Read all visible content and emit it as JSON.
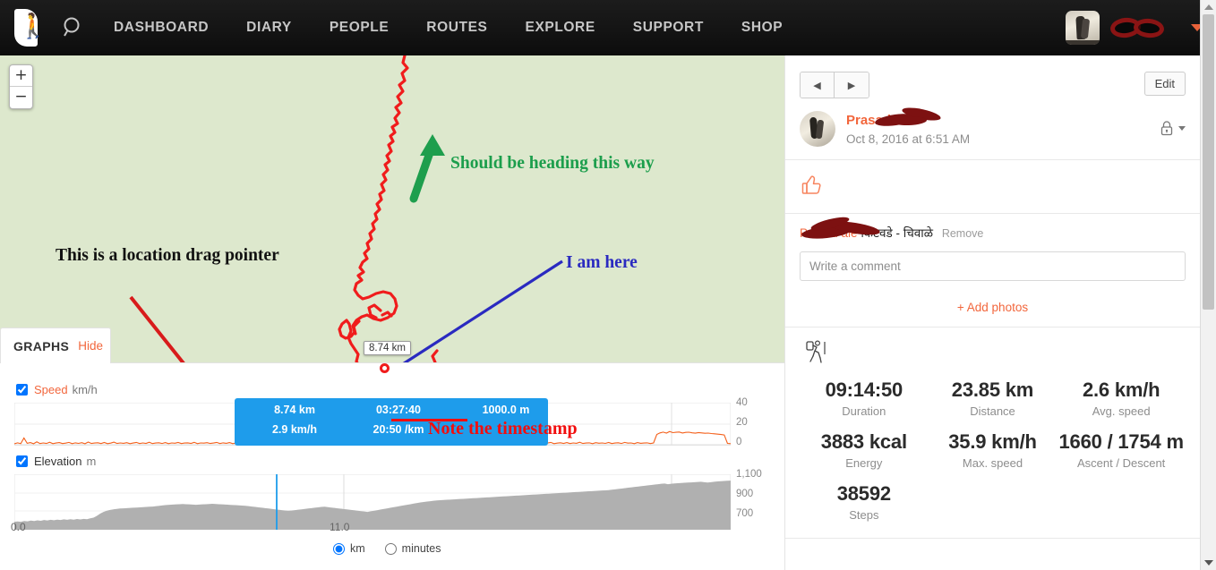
{
  "nav": {
    "logo_alt": "runner-logo",
    "search_icon": "search-icon",
    "links": [
      {
        "label": "DASHBOARD"
      },
      {
        "label": "DIARY"
      },
      {
        "label": "PEOPLE"
      },
      {
        "label": "ROUTES"
      },
      {
        "label": "EXPLORE"
      },
      {
        "label": "SUPPORT"
      },
      {
        "label": "SHOP"
      }
    ],
    "user_name_redacted": "",
    "caret_icon": "chevron-down-icon"
  },
  "map": {
    "background_color": "#dde8cd",
    "track_color": "#f01c1c",
    "zoom_in_label": "+",
    "zoom_out_label": "−",
    "marker_label": "8.74 km",
    "annotations": {
      "green": "Should be heading this way",
      "green_color": "#1c9e4c",
      "black": "This is a location drag pointer",
      "black_color": "#111111",
      "blue": "I am here",
      "blue_color": "#2a2ac0",
      "red": "Note the timestamp",
      "red_color": "#f20d0d"
    },
    "tooltip": {
      "background": "#1e9ceb",
      "distance": "8.74 km",
      "duration": "03:27:40",
      "elevation": "1000.0 m",
      "speed": "2.9 km/h",
      "pace": "20:50 /km"
    }
  },
  "graphs": {
    "tab_title": "GRAPHS",
    "hide_label": "Hide",
    "speed": {
      "name": "Speed",
      "unit": "km/h",
      "checked": true
    },
    "elevation": {
      "name": "Elevation",
      "unit": "m",
      "checked": true
    },
    "x_labels": [
      "0.0",
      "11.0"
    ],
    "units": [
      {
        "label": "km",
        "selected": true
      },
      {
        "label": "minutes",
        "selected": false
      }
    ]
  },
  "chart_data": [
    {
      "type": "line",
      "title": "Speed",
      "ylabel": "km/h",
      "xlabel": "km",
      "ylim": [
        0,
        48
      ],
      "yticks": [
        0,
        20,
        40
      ],
      "ytick_labels": [
        "0",
        "20",
        "40"
      ],
      "xlim": [
        0,
        23.85
      ],
      "xticks": [
        0,
        11
      ],
      "xtick_labels": [
        "0.0",
        "11.0"
      ],
      "grid": true,
      "line_color": "#f4601b",
      "cursor_x": 8.74,
      "cursor_color": "#1e9ceb",
      "values": [
        2.0,
        3.1,
        2.2,
        8.5,
        2.6,
        3.4,
        2.1,
        4.2,
        2.3,
        3.0,
        2.4,
        3.8,
        2.2,
        2.9,
        3.4,
        2.3,
        2.8,
        3.6,
        2.2,
        3.1,
        2.5,
        3.3,
        2.1,
        4.0,
        2.4,
        2.9,
        3.2,
        2.3,
        3.5,
        2.2,
        2.8,
        3.9,
        2.4,
        3.0,
        2.6,
        3.3,
        2.2,
        2.9,
        3.6,
        2.3,
        3.0,
        2.5,
        3.8,
        2.3,
        2.9,
        3.2,
        2.4,
        3.4,
        2.2,
        3.0,
        2.7,
        3.5,
        2.3,
        2.9,
        3.1,
        2.5,
        3.7,
        2.2,
        3.0,
        2.8,
        3.3,
        2.4,
        2.9,
        3.6,
        2.3,
        3.1,
        2.6,
        3.4,
        2.2,
        3.0,
        2.9,
        3.5,
        2.4,
        2.8,
        3.2,
        2.3,
        3.8,
        2.5,
        3.0,
        2.7,
        3.4,
        2.2,
        2.9,
        3.3,
        2.4,
        3.6,
        2.3,
        3.0,
        2.8,
        3.2,
        2.5,
        3.9,
        2.2,
        2.9,
        3.5,
        2.4,
        3.1,
        2.6,
        3.3,
        2.3,
        3.0,
        2.9,
        6.2,
        3.1,
        2.5,
        5.8,
        2.8,
        3.4,
        2.2,
        3.0,
        2.7,
        3.6,
        2.4,
        2.9,
        3.2,
        2.3,
        3.5,
        2.6,
        3.0,
        2.8,
        3.3,
        2.2,
        2.9,
        3.7,
        2.4,
        3.1,
        2.5,
        3.4,
        2.3,
        3.0,
        2.7,
        3.6,
        2.2,
        2.9,
        3.2,
        2.4,
        3.8,
        2.6,
        3.0,
        2.3,
        3.5,
        2.8,
        2.9,
        3.1,
        2.4,
        3.3,
        2.2,
        3.0,
        2.6,
        3.4,
        2.3,
        2.9,
        3.7,
        2.5,
        3.0,
        2.8,
        3.2,
        2.2,
        2.9,
        3.5,
        2.4,
        3.1,
        2.7,
        3.3,
        2.3,
        3.0,
        2.9,
        3.6,
        2.2,
        2.8,
        3.2,
        2.5,
        3.4,
        2.3,
        3.0,
        2.6,
        3.8,
        2.4,
        2.9,
        3.1,
        2.2,
        3.3,
        2.7,
        3.0,
        2.5,
        3.5,
        2.3,
        2.9,
        3.2,
        2.4,
        3.6,
        2.8,
        3.0,
        2.2,
        3.4,
        2.6,
        2.9,
        3.1,
        2.3,
        3.0,
        12.5,
        14.2,
        15.1,
        14.0,
        15.8,
        14.5,
        14.9,
        15.2,
        14.1,
        14.8,
        15.0,
        14.3,
        13.9,
        14.6,
        14.2,
        13.8,
        14.0,
        13.5,
        13.2,
        12.8,
        12.4,
        11.9,
        2.5,
        2.2
      ]
    },
    {
      "type": "area",
      "title": "Elevation",
      "ylabel": "m",
      "xlabel": "km",
      "ylim": [
        620,
        1180
      ],
      "yticks": [
        700,
        900,
        1100
      ],
      "ytick_labels": [
        "700",
        "900",
        "1,100"
      ],
      "xlim": [
        0,
        23.85
      ],
      "xticks": [
        0,
        11
      ],
      "xtick_labels": [
        "0.0",
        "11.0"
      ],
      "grid": true,
      "fill_color": "#b0b0b0",
      "cursor_x": 8.74,
      "cursor_color": "#1e9ceb",
      "values": [
        700,
        703,
        700,
        708,
        705,
        712,
        708,
        715,
        710,
        718,
        714,
        720,
        716,
        722,
        718,
        725,
        720,
        726,
        722,
        728,
        724,
        730,
        726,
        735,
        742,
        760,
        782,
        800,
        812,
        820,
        826,
        830,
        834,
        836,
        838,
        840,
        842,
        844,
        846,
        848,
        850,
        852,
        854,
        858,
        862,
        866,
        870,
        872,
        874,
        876,
        878,
        880,
        878,
        876,
        874,
        872,
        874,
        876,
        878,
        880,
        882,
        880,
        878,
        876,
        874,
        872,
        870,
        868,
        866,
        864,
        862,
        858,
        854,
        850,
        846,
        842,
        838,
        834,
        830,
        826,
        822,
        818,
        814,
        812,
        814,
        818,
        822,
        826,
        830,
        834,
        838,
        842,
        846,
        850,
        852,
        848,
        844,
        840,
        836,
        832,
        828,
        824,
        820,
        816,
        812,
        808,
        804,
        800,
        806,
        812,
        818,
        824,
        830,
        836,
        842,
        848,
        854,
        860,
        866,
        872,
        878,
        884,
        890,
        896,
        900,
        904,
        908,
        912,
        916,
        918,
        920,
        922,
        924,
        926,
        928,
        930,
        932,
        934,
        936,
        938,
        940,
        942,
        944,
        946,
        948,
        950,
        952,
        954,
        956,
        958,
        960,
        962,
        964,
        966,
        968,
        970,
        972,
        974,
        976,
        978,
        980,
        982,
        984,
        986,
        988,
        990,
        992,
        994,
        996,
        998,
        1000,
        1002,
        1004,
        1006,
        1008,
        1010,
        1012,
        1014,
        1016,
        1018,
        1020,
        1024,
        1028,
        1032,
        1036,
        1040,
        1044,
        1048,
        1052,
        1056,
        1060,
        1064,
        1068,
        1072,
        1076,
        1080,
        1084,
        1086,
        1080,
        1084,
        1088,
        1090,
        1092,
        1094,
        1096,
        1098,
        1100,
        1102,
        1104,
        1100,
        1096,
        1100,
        1104,
        1108,
        1110,
        1112,
        1114,
        1116
      ]
    }
  ],
  "right_panel": {
    "prev_label": "◀",
    "next_label": "▶",
    "edit_label": "Edit",
    "author_name": "Prasad  ale",
    "post_date": "Oct 8, 2016 at 6:51 AM",
    "privacy_icon": "lock-icon",
    "like_icon": "thumbs-up-icon",
    "comment": {
      "author": "Prasad  ale",
      "text": "किटवडे - चिवाळे",
      "remove_label": "Remove"
    },
    "comment_placeholder": "Write a comment",
    "comment_value": "",
    "add_photos_label": "+ Add photos",
    "activity_icon": "hiker-icon",
    "stats": [
      {
        "value": "09:14:50",
        "label": "Duration"
      },
      {
        "value": "23.85 km",
        "label": "Distance"
      },
      {
        "value": "2.6 km/h",
        "label": "Avg. speed"
      },
      {
        "value": "3883 kcal",
        "label": "Energy"
      },
      {
        "value": "35.9 km/h",
        "label": "Max. speed"
      },
      {
        "value": "1660 / 1754 m",
        "label": "Ascent / Descent"
      },
      {
        "value": "38592",
        "label": "Steps"
      }
    ]
  }
}
